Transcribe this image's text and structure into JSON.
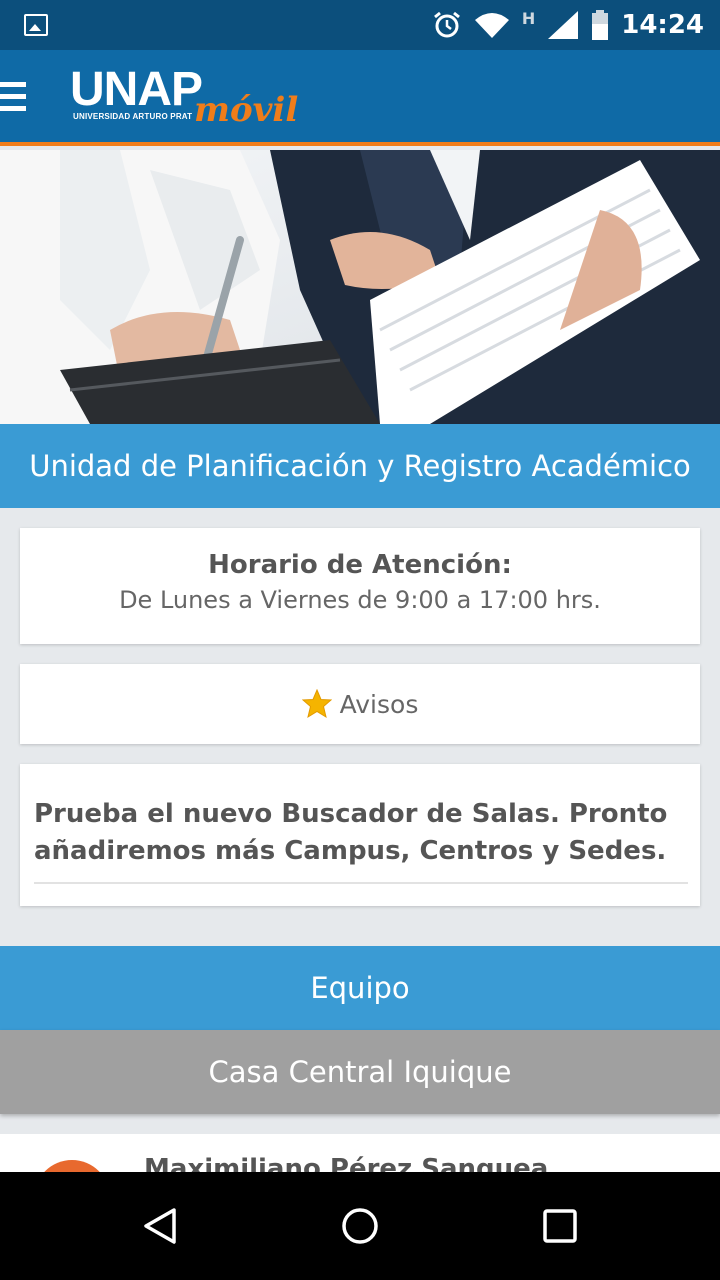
{
  "status_bar": {
    "time": "14:24",
    "network_label": "H",
    "icons": [
      "gallery-icon",
      "alarm-icon",
      "wifi-icon",
      "signal-icon",
      "battery-icon"
    ]
  },
  "app_bar": {
    "logo_main": "UNAP",
    "logo_sub": "UNIVERSIDAD ARTURO PRAT",
    "logo_script": "móvil",
    "accent_color": "#f07d1a",
    "brand_color": "#0f6aa6"
  },
  "unit": {
    "title": "Unidad de Planificación y Registro Académico"
  },
  "hours": {
    "label": "Horario de Atención:",
    "value": "De Lunes a Viernes de 9:00 a 17:00 hrs."
  },
  "notices": {
    "label": "Avisos",
    "icon": "star-icon",
    "items": [
      "Prueba el nuevo Buscador de Salas. Pronto añadiremos más Campus, Centros y Sedes."
    ]
  },
  "team": {
    "title": "Equipo",
    "campus": "Casa Central Iquique",
    "members": [
      {
        "name": "Maximiliano Pérez Sanguea"
      }
    ]
  },
  "nav": {
    "icons": [
      "back-icon",
      "home-icon",
      "recents-icon"
    ]
  }
}
